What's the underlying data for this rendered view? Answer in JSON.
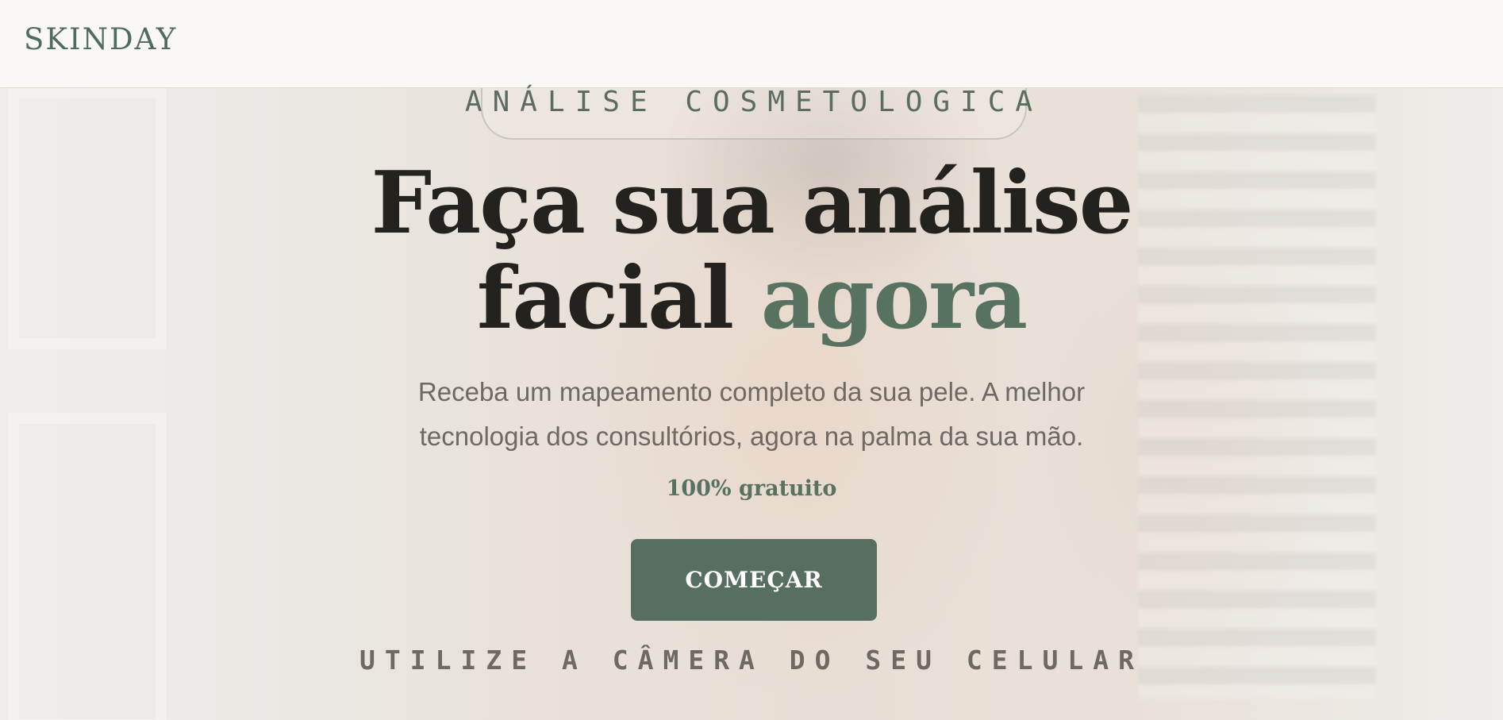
{
  "header": {
    "logo": "SKINDAY"
  },
  "hero": {
    "eyebrow": "ANÁLISE COSMETOLOGICA",
    "headline_line1": "Faça sua análise",
    "headline_line2_plain": "facial",
    "headline_line2_accent": "agora",
    "subtitle_line1": "Receba um mapeamento completo da sua pele. A melhor",
    "subtitle_line2": "tecnologia dos consultórios, agora na palma da sua mão.",
    "price_note": "100% gratuito",
    "cta_label": "COMEÇAR",
    "hint": "UTILIZE A CÂMERA DO SEU CELULAR"
  },
  "colors": {
    "brand_green": "#566f60",
    "heading": "#24221f",
    "body_text": "#6f6963",
    "header_bg": "#f9f8f5"
  }
}
